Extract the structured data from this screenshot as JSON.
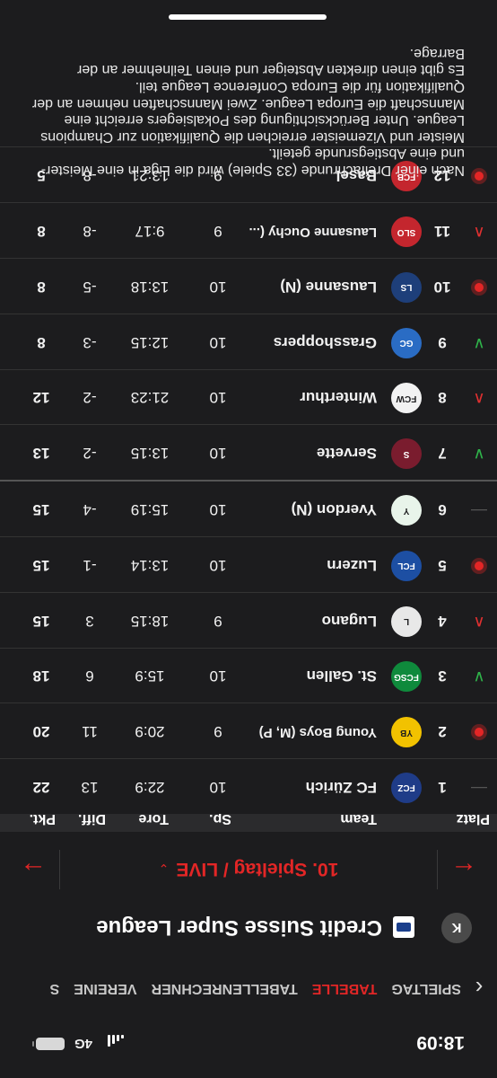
{
  "status_bar": {
    "time": "18:09",
    "network": "4G"
  },
  "nav": {
    "back_icon": "chevron-left-icon",
    "tabs": [
      "SPIELTAG",
      "TABELLE",
      "TABELLENRECHNER",
      "VEREINE",
      "S"
    ],
    "active_tab": "TABELLE"
  },
  "league": {
    "name": "Credit Suisse Super League",
    "collapse_label": "K"
  },
  "round": {
    "label": "10. Spieltag / LIVE",
    "caret": "⌄",
    "prev_arrow": "←",
    "next_arrow": "→"
  },
  "table": {
    "headers": {
      "platz": "Platz",
      "team": "Team",
      "sp": "Sp.",
      "tore": "Tore",
      "diff": "Diff.",
      "pkt": "Pkt."
    },
    "rows": [
      {
        "trend": "same",
        "pos": "1",
        "team": "FC Zürich",
        "sp": "10",
        "tore": "22:9",
        "diff": "13",
        "pkt": "22",
        "crest_color": "#1f3c88",
        "crest_text": "FCZ"
      },
      {
        "trend": "live",
        "pos": "2",
        "team": "Young Boys (M, P)",
        "sp": "9",
        "tore": "20:9",
        "diff": "11",
        "pkt": "20",
        "crest_color": "#f2c200",
        "crest_text": "YB"
      },
      {
        "trend": "up",
        "pos": "3",
        "team": "St. Gallen",
        "sp": "10",
        "tore": "15:9",
        "diff": "6",
        "pkt": "18",
        "crest_color": "#0f8a3c",
        "crest_text": "FCSG"
      },
      {
        "trend": "down",
        "pos": "4",
        "team": "Lugano",
        "sp": "9",
        "tore": "18:15",
        "diff": "3",
        "pkt": "15",
        "crest_color": "#e8e8e8",
        "crest_text": "L"
      },
      {
        "trend": "live",
        "pos": "5",
        "team": "Luzern",
        "sp": "10",
        "tore": "13:14",
        "diff": "-1",
        "pkt": "15",
        "crest_color": "#1d4fa3",
        "crest_text": "FCL"
      },
      {
        "trend": "same",
        "pos": "6",
        "team": "Yverdon (N)",
        "sp": "10",
        "tore": "15:19",
        "diff": "-4",
        "pkt": "15",
        "crest_color": "#e8f4ea",
        "crest_text": "Y"
      },
      {
        "trend": "up",
        "pos": "7",
        "team": "Servette",
        "sp": "10",
        "tore": "13:15",
        "diff": "-2",
        "pkt": "13",
        "crest_color": "#7a1c2e",
        "crest_text": "S"
      },
      {
        "trend": "down",
        "pos": "8",
        "team": "Winterthur",
        "sp": "10",
        "tore": "21:23",
        "diff": "-2",
        "pkt": "12",
        "crest_color": "#f2f2f2",
        "crest_text": "FCW"
      },
      {
        "trend": "up",
        "pos": "9",
        "team": "Grasshoppers",
        "sp": "10",
        "tore": "12:15",
        "diff": "-3",
        "pkt": "8",
        "crest_color": "#2a6cc4",
        "crest_text": "GC"
      },
      {
        "trend": "live",
        "pos": "10",
        "team": "Lausanne (N)",
        "sp": "10",
        "tore": "13:18",
        "diff": "-5",
        "pkt": "8",
        "crest_color": "#1e3f7a",
        "crest_text": "LS"
      },
      {
        "trend": "down",
        "pos": "11",
        "team": "Lausanne Ouchy (...",
        "sp": "9",
        "tore": "9:17",
        "diff": "-8",
        "pkt": "8",
        "crest_color": "#c4262e",
        "crest_text": "SLO"
      },
      {
        "trend": "live",
        "pos": "12",
        "team": "Basel",
        "sp": "9",
        "tore": "13:21",
        "diff": "-8",
        "pkt": "5",
        "crest_color": "#c4262e",
        "crest_text": "FCB"
      }
    ]
  },
  "note": {
    "line1": "Nach einer Dreifachrunde (33 Spiele) wird die Liga in eine Meister- und eine Abstiegsrunde geteilt.",
    "line2": "Meister und Vizemeister erreichen die Qualifikation zur Champions League. Unter Berücksichtigung des Pokalsiegers erreicht eine Mannschaft die Europa League. Zwei Mannschaften nehmen an der Qualifikation für die Europa Conference League teil.",
    "line3": "Es gibt einen direkten Absteiger und einen Teilnehmer an der Barrage."
  }
}
